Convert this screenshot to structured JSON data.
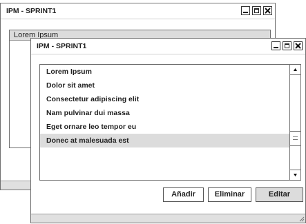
{
  "back_window": {
    "title": "IPM - SPRINT1",
    "panel_header": "Lorem Ipsum"
  },
  "front_window": {
    "title": "IPM - SPRINT1",
    "items": [
      "Lorem Ipsum",
      "Dolor sit amet",
      "Consectetur adipiscing elit",
      "Nam pulvinar dui massa",
      "Eget ornare leo tempor eu",
      "Donec at malesuada est"
    ],
    "selected_item": "Donec at malesuada est",
    "buttons": {
      "add": "Añadir",
      "delete": "Eliminar",
      "edit": "Editar"
    }
  }
}
